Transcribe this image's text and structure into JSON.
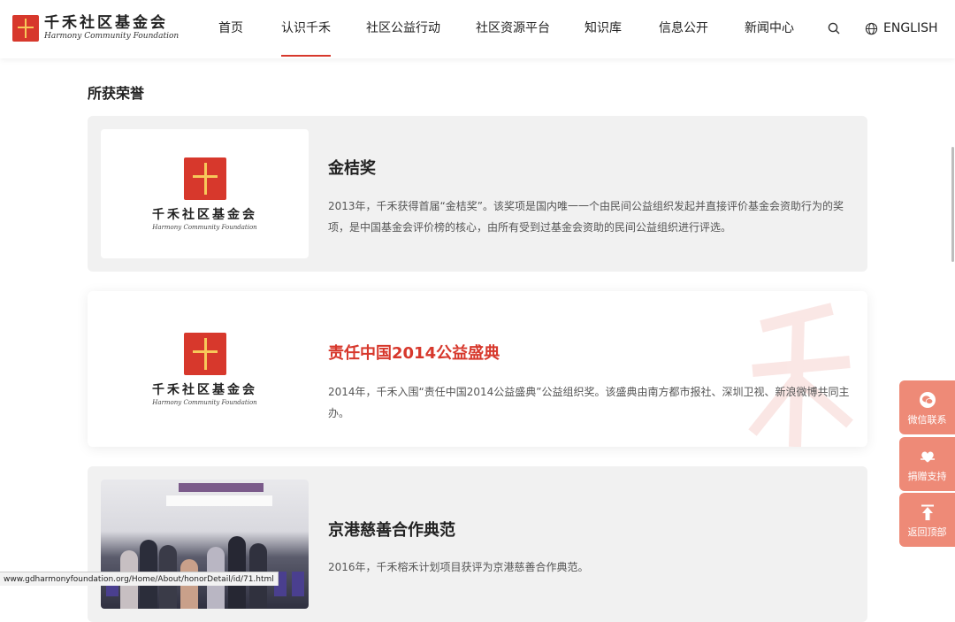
{
  "header": {
    "logo_cn": "千禾社区基金会",
    "logo_en": "Harmony Community Foundation",
    "nav": [
      {
        "label": "首页"
      },
      {
        "label": "认识千禾"
      },
      {
        "label": "社区公益行动"
      },
      {
        "label": "社区资源平台"
      },
      {
        "label": "知识库"
      },
      {
        "label": "信息公开"
      },
      {
        "label": "新闻中心"
      }
    ],
    "active_nav": "认识千禾",
    "search_icon": "search-icon",
    "lang_label": "ENGLISH",
    "lang_icon": "globe-icon"
  },
  "section": {
    "title": "所获荣誉"
  },
  "honors": [
    {
      "title": "金桔奖",
      "desc": "2013年，千禾获得首届“金桔奖”。该奖项是国内唯一一个由民间公益组织发起并直接评价基金会资助行为的奖项，是中国基金会评价榜的核心，由所有受到过基金会资助的民间公益组织进行评选。",
      "img_cn": "千禾社区基金会",
      "img_en": "Harmony Community Foundation"
    },
    {
      "title": "责任中国2014公益盛典",
      "desc": "2014年，千禾入围“责任中国2014公益盛典”公益组织奖。该盛典由南方都市报社、深圳卫视、新浪微博共同主办。",
      "img_cn": "千禾社区基金会",
      "img_en": "Harmony Community Foundation"
    },
    {
      "title": "京港慈善合作典范",
      "desc": "2016年，千禾榕禾计划项目获评为京港慈善合作典范。"
    }
  ],
  "side_float": [
    {
      "label": "微信联系",
      "icon": "wechat-icon"
    },
    {
      "label": "捐赠支持",
      "icon": "heart-hands-icon"
    },
    {
      "label": "返回顶部",
      "icon": "arrow-up-icon"
    }
  ],
  "status_url": "www.gdharmonyfoundation.org/Home/About/honorDetail/id/71.html",
  "colors": {
    "accent": "#d7382c",
    "side": "#ee8a77",
    "card_gray": "#f1f1f1"
  }
}
